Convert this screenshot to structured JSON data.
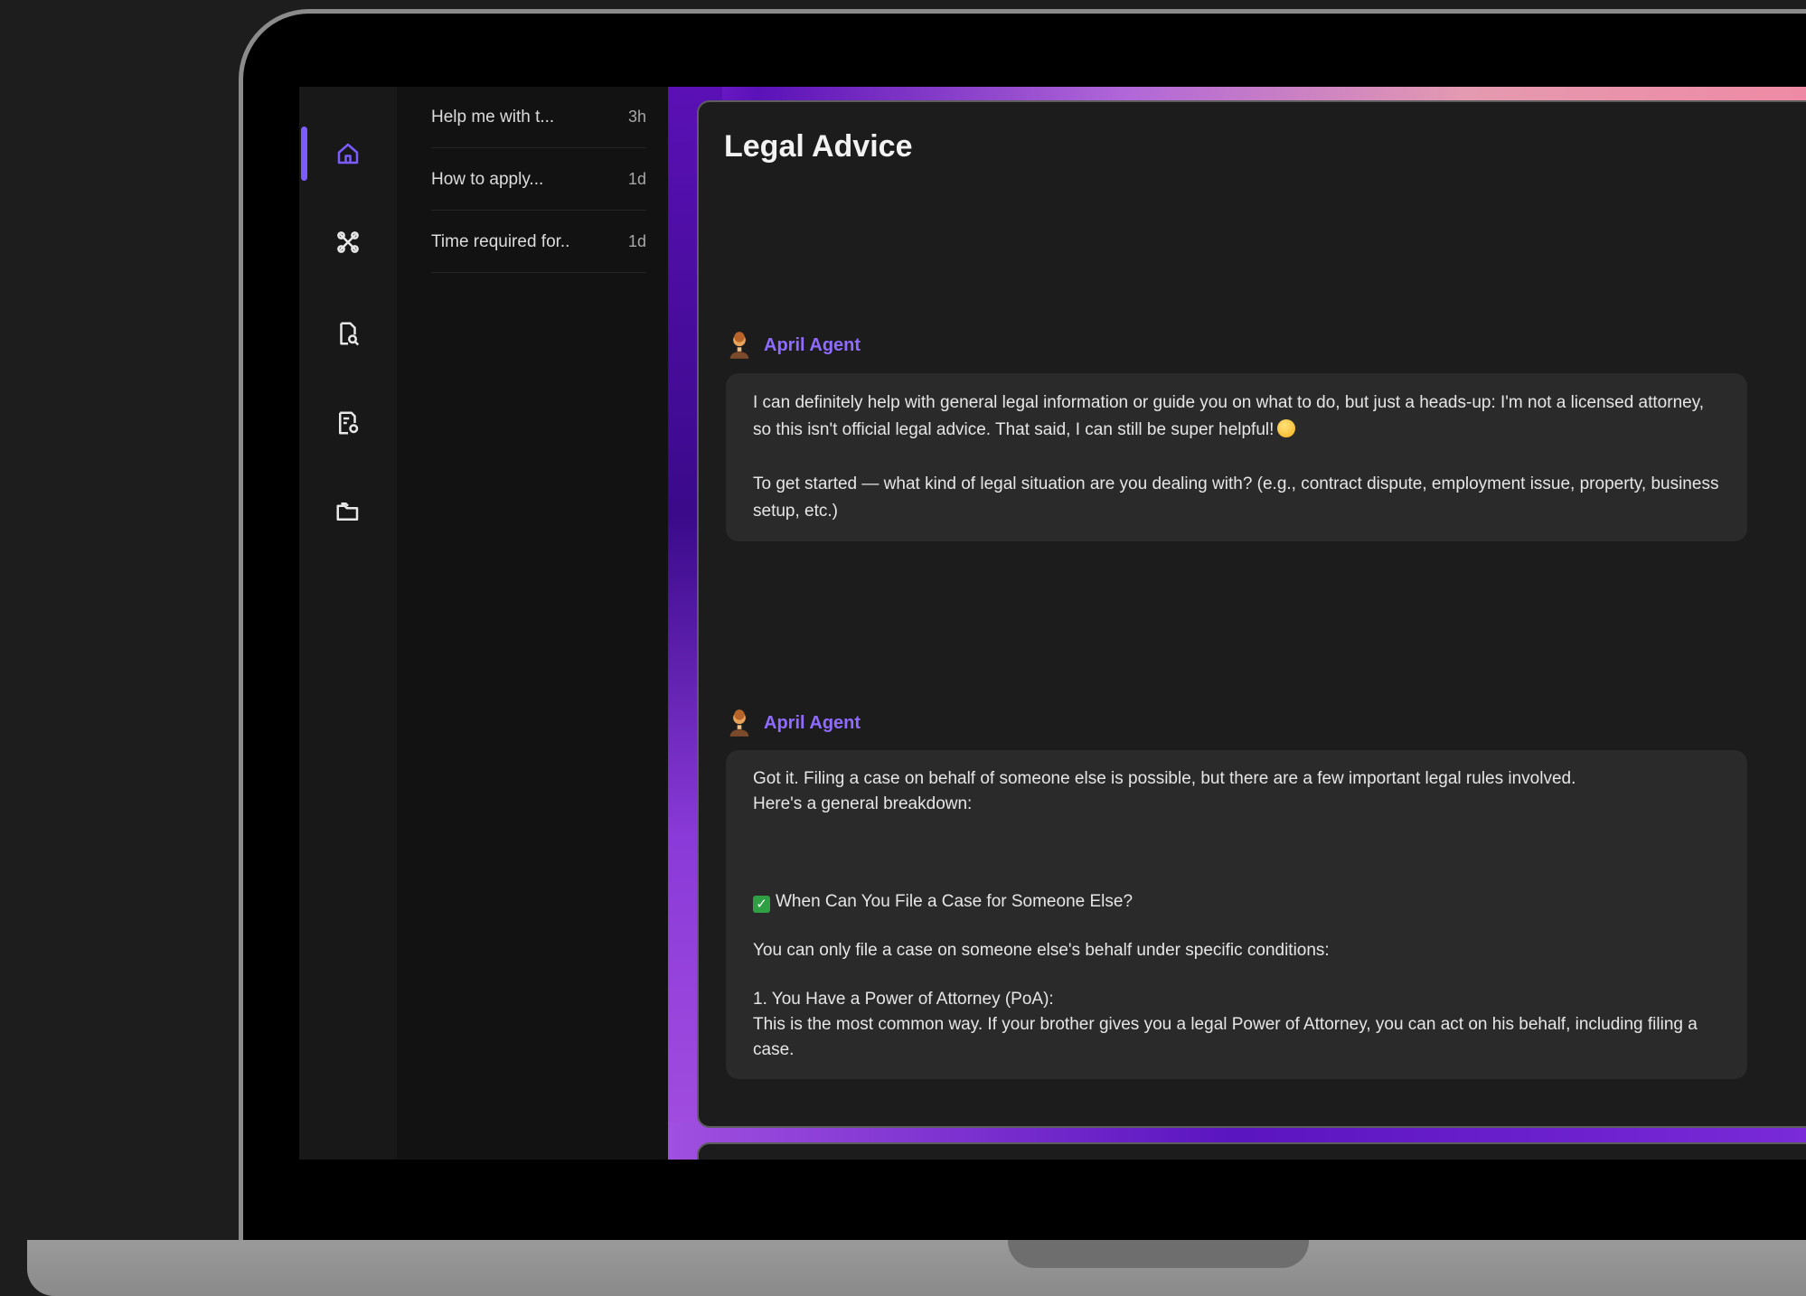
{
  "sidebar": {
    "icons": [
      {
        "name": "home-icon",
        "active": true
      },
      {
        "name": "tools-icon",
        "active": false
      },
      {
        "name": "document-search-icon",
        "active": false
      },
      {
        "name": "document-settings-icon",
        "active": false
      },
      {
        "name": "folder-icon",
        "active": false
      }
    ],
    "accent_color": "#7c5cff"
  },
  "history": {
    "items": [
      {
        "title": "Help me with t...",
        "time": "3h"
      },
      {
        "title": "How to apply...",
        "time": "1d"
      },
      {
        "title": "Time required for..",
        "time": "1d"
      }
    ]
  },
  "chat": {
    "title": "Legal Advice",
    "messages": [
      {
        "agent": "April Agent",
        "paragraphs": [
          "I can definitely help with general legal information or guide you on what to do, but just a heads-up: I'm not a licensed attorney, so this isn't official legal advice. That said, I can still be super helpful!",
          "To get started — what kind of legal situation are you dealing with? (e.g., contract dispute, employment issue, property, business setup, etc.)"
        ]
      },
      {
        "agent": "April Agent",
        "line1": "Got it. Filing a case on behalf of someone else is possible, but there are a few important legal rules involved.",
        "line2": "Here's a general breakdown:",
        "heading": "When Can You File a Case for Someone Else?",
        "line3": "You can only file a case on someone else's behalf under specific conditions:",
        "point_title": "1. You Have a Power of Attorney (PoA):",
        "point_body": "This is the most common way. If your brother gives you a legal Power of Attorney, you can act on his behalf, including filing a case."
      }
    ]
  }
}
